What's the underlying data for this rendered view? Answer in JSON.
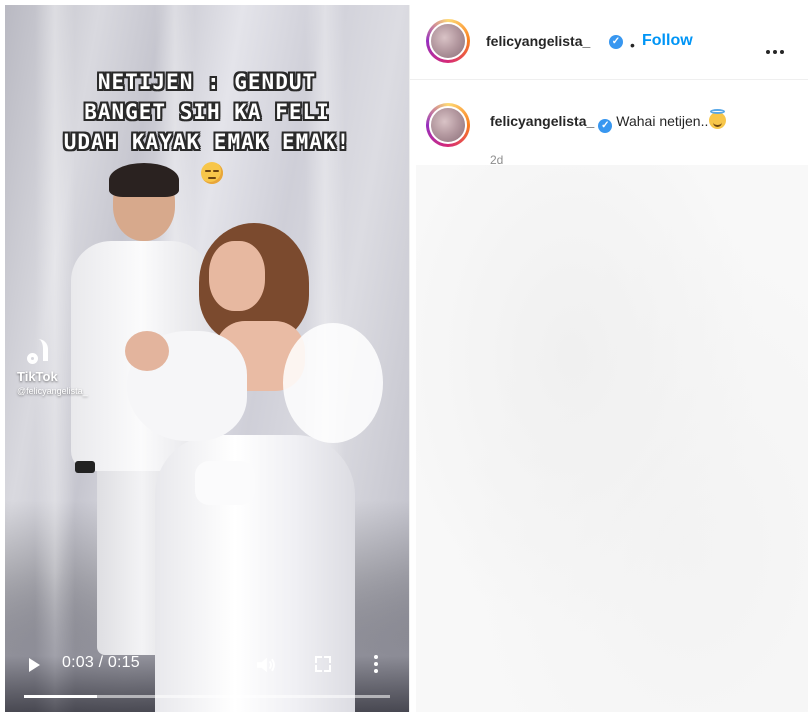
{
  "video": {
    "caption_lines": [
      "NETIJEN : GENDUT",
      "BANGET SIH KA FELI",
      "UDAH KAYAK EMAK EMAK!"
    ],
    "caption_emoji": "relieved-face-emoji",
    "watermark": {
      "brand": "TikTok",
      "handle": "@felicyangelista_"
    },
    "player": {
      "time_display": "0:03 / 0:15",
      "progress": 0.2,
      "play_icon": "play-icon",
      "volume_icon": "volume-icon",
      "fullscreen_icon": "fullscreen-icon",
      "more_icon": "more-vertical-icon"
    }
  },
  "header": {
    "username": "felicyangelista_",
    "verified": true,
    "separator": "•",
    "follow_label": "Follow",
    "more_icon": "more-horizontal-icon"
  },
  "post": {
    "username": "felicyangelista_",
    "verified": true,
    "caption": "Wahai netijen..",
    "caption_emoji": "smiling-face-with-halo-emoji",
    "time_ago": "2d"
  },
  "colors": {
    "accent": "#0095f6",
    "verified": "#3897f0",
    "text": "#262626",
    "muted": "#8e8e8e"
  }
}
